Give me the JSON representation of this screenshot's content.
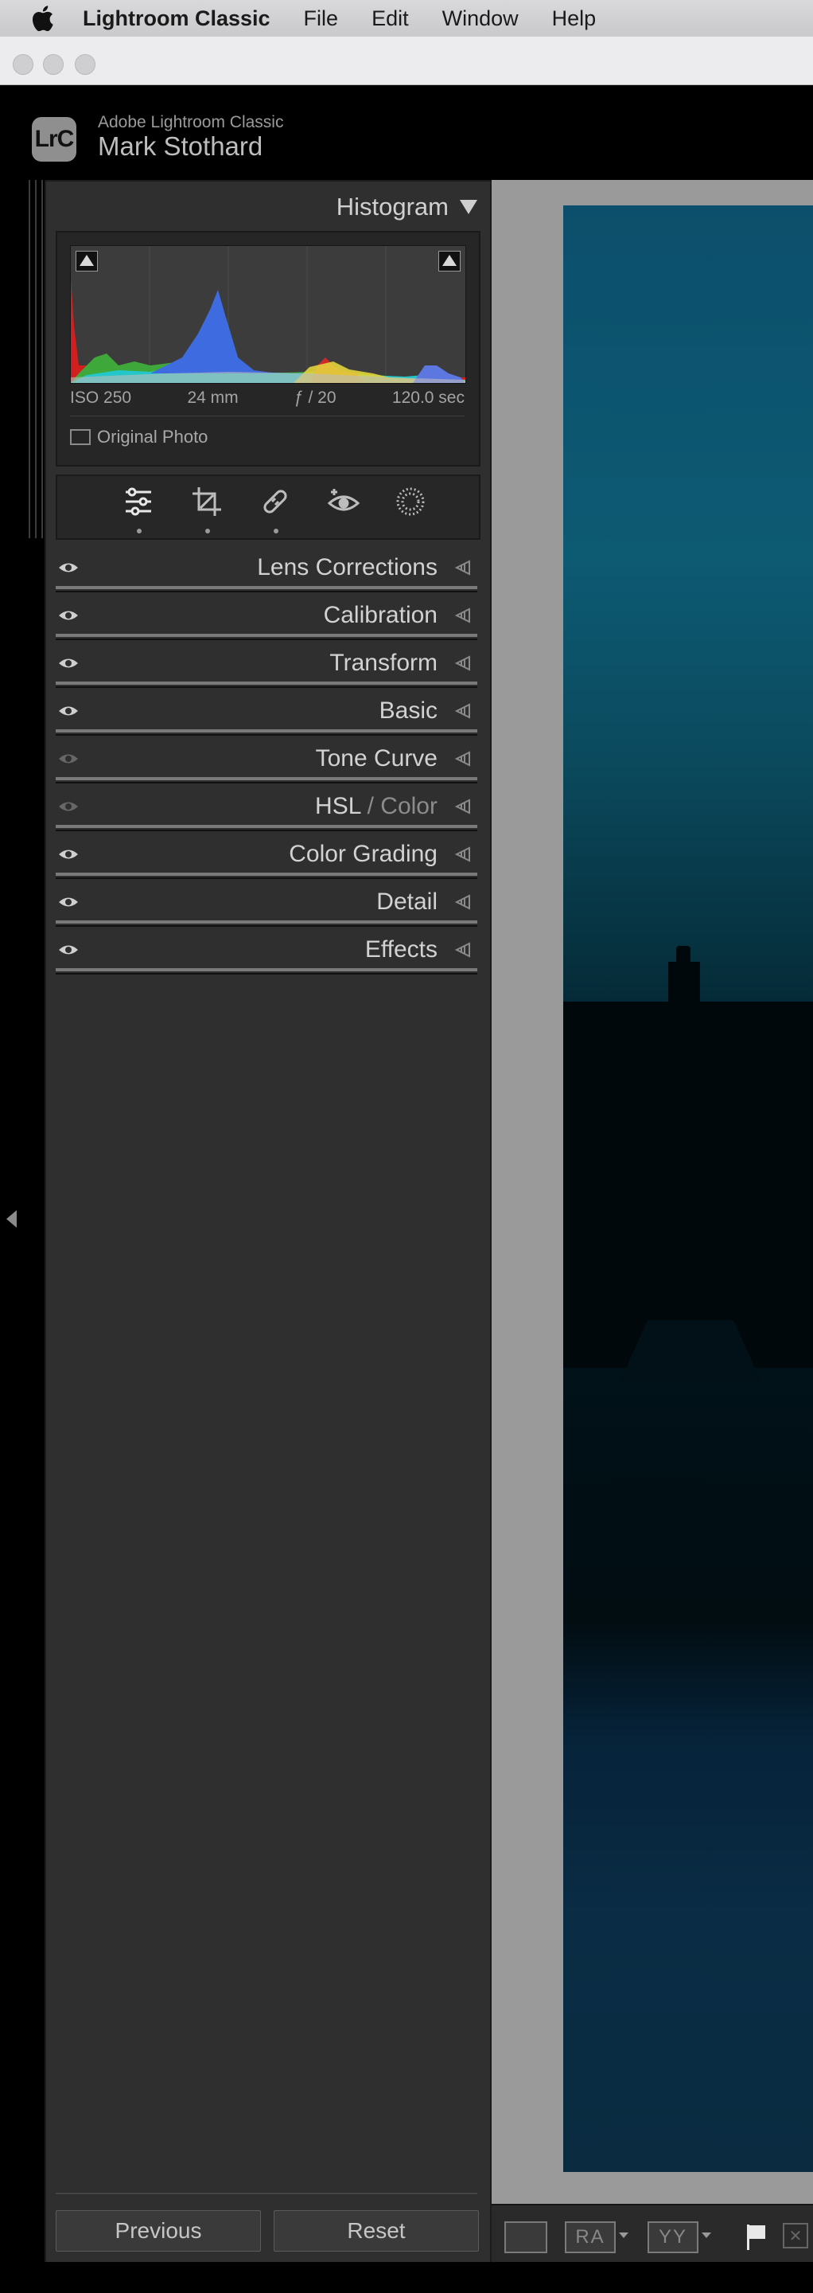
{
  "menubar": {
    "app": "Lightroom Classic",
    "items": [
      "File",
      "Edit",
      "Window",
      "Help"
    ]
  },
  "identity": {
    "badge": "LrC",
    "product": "Adobe Lightroom Classic",
    "user": "Mark Stothard"
  },
  "histogram": {
    "title": "Histogram",
    "iso": "ISO 250",
    "focal": "24 mm",
    "aperture": "ƒ / 20",
    "shutter": "120.0 sec",
    "original_photo": "Original Photo"
  },
  "tools": [
    "edit-sliders-icon",
    "crop-icon",
    "healing-icon",
    "red-eye-icon",
    "masking-icon"
  ],
  "sections": [
    {
      "label": "Lens Corrections",
      "enabled": true
    },
    {
      "label": "Calibration",
      "enabled": true
    },
    {
      "label": "Transform",
      "enabled": true
    },
    {
      "label": "Basic",
      "enabled": true
    },
    {
      "label": "Tone Curve",
      "enabled": false
    },
    {
      "label": "HSL",
      "label_extra": "Color",
      "enabled": false
    },
    {
      "label": "Color Grading",
      "enabled": true
    },
    {
      "label": "Detail",
      "enabled": true
    },
    {
      "label": "Effects",
      "enabled": true
    }
  ],
  "buttons": {
    "previous": "Previous",
    "reset": "Reset"
  },
  "toolbar": {
    "ra": "RA",
    "yy": "YY",
    "reject": "✕"
  },
  "colors": {
    "panel_bg": "#2f2f2f",
    "accent_text": "#d2d2d2"
  }
}
